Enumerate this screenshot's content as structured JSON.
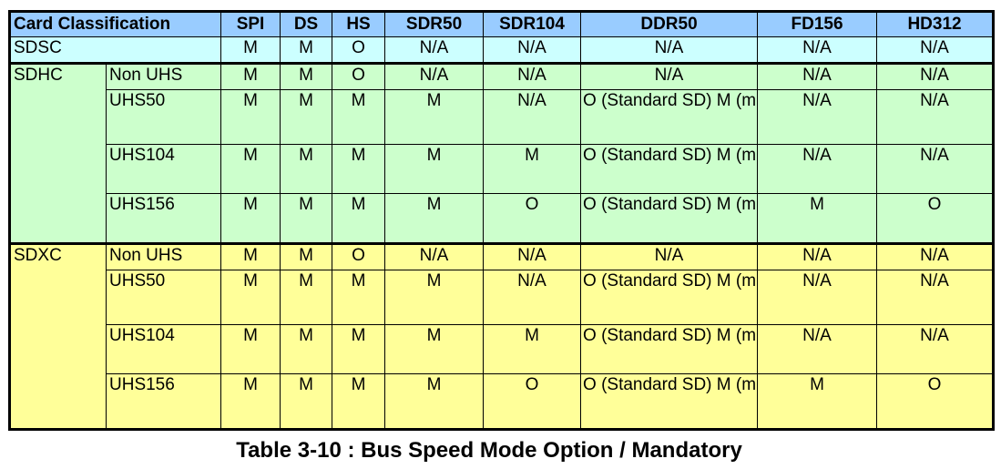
{
  "table": {
    "headers": {
      "classification": "Card Classification",
      "modes": [
        "SPI",
        "DS",
        "HS",
        "SDR50",
        "SDR104",
        "DDR50",
        "FD156",
        "HD312"
      ]
    },
    "colors": {
      "header": "#99ccff",
      "SDSC": "#ccffff",
      "SDHC": "#ccffcc",
      "SDXC": "#ffff99"
    },
    "sdsc": {
      "label": "SDSC",
      "values": [
        "M",
        "M",
        "O",
        "N/A",
        "N/A",
        "N/A",
        "N/A",
        "N/A"
      ]
    },
    "sdhc": {
      "label": "SDHC",
      "rows": [
        {
          "sub": "Non UHS",
          "values": [
            "M",
            "M",
            "O",
            "N/A",
            "N/A",
            "N/A",
            "N/A",
            "N/A"
          ]
        },
        {
          "sub": "UHS50",
          "values": [
            "M",
            "M",
            "M",
            "M",
            "N/A",
            "O (Standard SD)\nM (microSD)",
            "N/A",
            "N/A"
          ]
        },
        {
          "sub": "UHS104",
          "values": [
            "M",
            "M",
            "M",
            "M",
            "M",
            "O (Standard SD)\nM (microSD)",
            "N/A",
            "N/A"
          ]
        },
        {
          "sub": "UHS156",
          "values": [
            "M",
            "M",
            "M",
            "M",
            "O",
            "O (Standard SD)\nM (microSD)",
            "M",
            "O"
          ]
        }
      ]
    },
    "sdxc": {
      "label": "SDXC",
      "rows": [
        {
          "sub": "Non UHS",
          "values": [
            "M",
            "M",
            "O",
            "N/A",
            "N/A",
            "N/A",
            "N/A",
            "N/A"
          ]
        },
        {
          "sub": "UHS50",
          "values": [
            "M",
            "M",
            "M",
            "M",
            "N/A",
            "O (Standard SD)\nM (microSD)",
            "N/A",
            "N/A"
          ]
        },
        {
          "sub": "UHS104",
          "values": [
            "M",
            "M",
            "M",
            "M",
            "M",
            "O (Standard SD)\nM (microSD)",
            "N/A",
            "N/A"
          ]
        },
        {
          "sub": "UHS156",
          "values": [
            "M",
            "M",
            "M",
            "M",
            "O",
            "O (Standard SD)\nM (microSD)",
            "M",
            "O"
          ]
        }
      ]
    }
  },
  "caption": "Table 3-10 : Bus Speed Mode Option / Mandatory"
}
